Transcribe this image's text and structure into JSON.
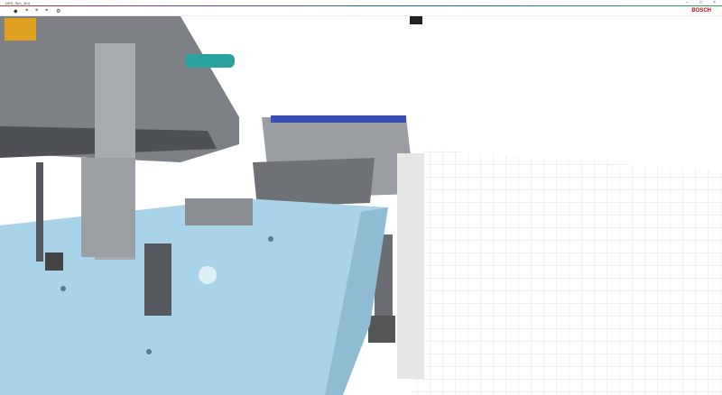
{
  "window": {
    "title": "DRS_Sim_3D4",
    "minimize": "–",
    "maximize": "□",
    "close": "×"
  },
  "toolbar": {
    "items": [
      {
        "icon": "select-icon",
        "glyph": "◆"
      },
      {
        "icon": "view-icon-1",
        "glyph": "⌖"
      },
      {
        "icon": "view-icon-2",
        "glyph": "⌖"
      },
      {
        "icon": "view-icon-3",
        "glyph": "⌖"
      },
      {
        "icon": "settings-icon",
        "glyph": "⚙"
      }
    ]
  },
  "brand": {
    "logo": "BOSCH",
    "color": "#d0021b"
  },
  "scene": {
    "floor_color": "#ffffff",
    "grid_color": "#dcdcdc",
    "table_color": "#a9d3e8",
    "machine_color": "#8a8e93"
  }
}
